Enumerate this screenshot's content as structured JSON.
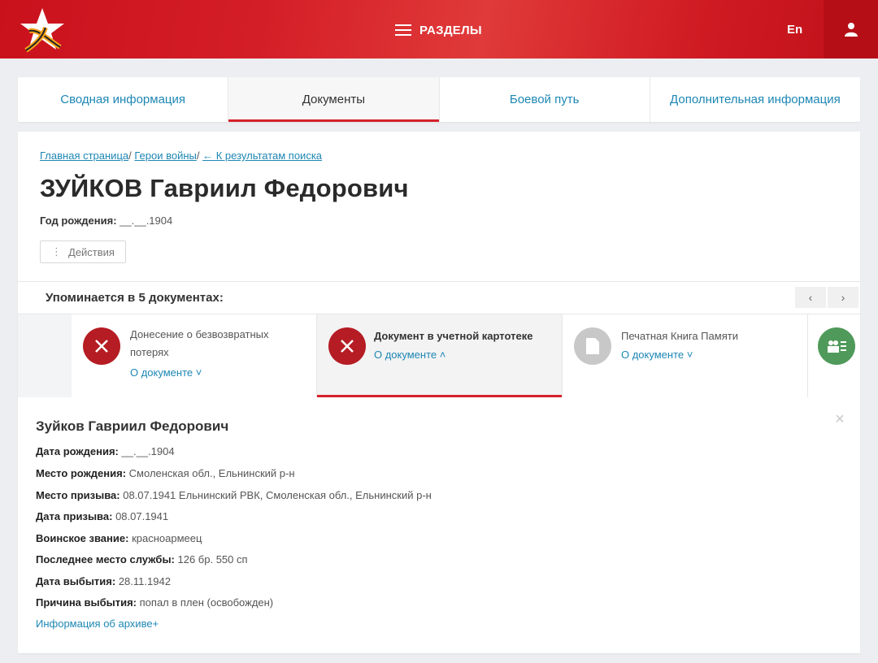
{
  "header": {
    "menu_label": "РАЗДЕЛЫ",
    "lang_label": "En",
    "brand_color": "#d41e27"
  },
  "tabs": [
    {
      "label": "Сводная информация",
      "active": false
    },
    {
      "label": "Документы",
      "active": true
    },
    {
      "label": "Боевой путь",
      "active": false
    },
    {
      "label": "Дополнительная информация",
      "active": false
    }
  ],
  "breadcrumb": {
    "home": "Главная страница",
    "sep1": "/ ",
    "heroes": "Герои войны",
    "sep2": "/ ",
    "back": "← К результатам поиска"
  },
  "person": {
    "name": "ЗУЙКОВ Гавриил Федорович",
    "birth_label": "Год рождения:",
    "birth_value": "__.__.1904"
  },
  "actions_label": "Действия",
  "mentions_label": "Упоминается в 5 документах:",
  "nav": {
    "prev": "‹",
    "next": "›"
  },
  "documents": [
    {
      "title_line1": "Донесение о безвозвратных",
      "title_line2": "потерях",
      "link": "О документе ˅",
      "icon": "cross-icon",
      "color": "#b51c24"
    },
    {
      "title_line1": "Документ в учетной картотеке",
      "title_line2": "",
      "link": "О документе ˄",
      "icon": "cross-icon",
      "color": "#b51c24",
      "active": true
    },
    {
      "title_line1": "Печатная Книга Памяти",
      "title_line2": "",
      "link": "О документе ˅",
      "icon": "document-icon",
      "color": "#c8c8c8"
    },
    {
      "title_line1": "",
      "title_line2": "",
      "link": "",
      "icon": "people-list-icon",
      "color": "#4f9a5a"
    }
  ],
  "details": {
    "name": "Зуйков Гавриил Федорович",
    "rows": [
      {
        "label": "Дата рождения:",
        "value": "__.__.1904"
      },
      {
        "label": "Место рождения:",
        "value": "Смоленская обл., Ельнинский р-н"
      },
      {
        "label": "Место призыва:",
        "value": "08.07.1941 Ельнинский РВК, Смоленская обл., Ельнинский р-н"
      },
      {
        "label": "Дата призыва:",
        "value": "08.07.1941"
      },
      {
        "label": "Воинское звание:",
        "value": "красноармеец"
      },
      {
        "label": "Последнее место службы:",
        "value": "126 бр. 550 сп"
      },
      {
        "label": "Дата выбытия:",
        "value": "28.11.1942"
      },
      {
        "label": "Причина выбытия:",
        "value": "попал в плен (освобожден)"
      }
    ],
    "archive_link": "Информация об архиве+",
    "close": "×"
  }
}
